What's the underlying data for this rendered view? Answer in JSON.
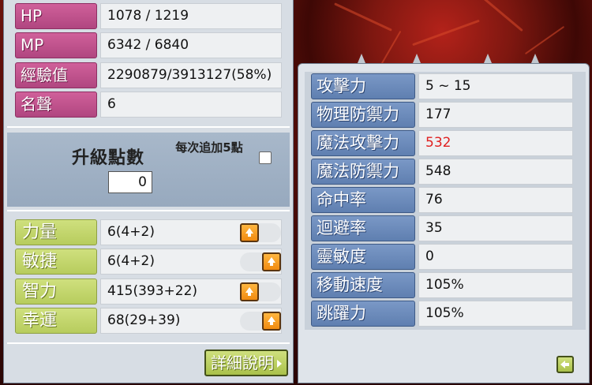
{
  "basic_stats": [
    {
      "label": "HP",
      "value": "1078 / 1219"
    },
    {
      "label": "MP",
      "value": "6342 / 6840"
    },
    {
      "label": "經驗值",
      "value": "2290879/3913127(58%)"
    },
    {
      "label": "名聲",
      "value": "6"
    }
  ],
  "ap_section": {
    "label": "升級點數",
    "value": "0",
    "auto_add_label": "每次追加5點",
    "auto_add_checked": false
  },
  "attributes": [
    {
      "label": "力量",
      "value": "6(4+2)",
      "button_side": "left"
    },
    {
      "label": "敏捷",
      "value": "6(4+2)",
      "button_side": "right"
    },
    {
      "label": "智力",
      "value": "415(393+22)",
      "button_side": "left"
    },
    {
      "label": "幸運",
      "value": "68(29+39)",
      "button_side": "right"
    }
  ],
  "detail_button": "詳細說明",
  "detail_stats": [
    {
      "label": "攻擊力",
      "value": "5 ~ 15"
    },
    {
      "label": "物理防禦力",
      "value": "177"
    },
    {
      "label": "魔法攻擊力",
      "value": "532",
      "highlight": "#e02020"
    },
    {
      "label": "魔法防禦力",
      "value": "548"
    },
    {
      "label": "命中率",
      "value": "76"
    },
    {
      "label": "迴避率",
      "value": "35"
    },
    {
      "label": "靈敏度",
      "value": "0"
    },
    {
      "label": "移動速度",
      "value": "105%"
    },
    {
      "label": "跳躍力",
      "value": "105%"
    }
  ],
  "icons": {
    "stat_up": "up-arrow-icon",
    "collapse": "left-arrow-icon"
  },
  "colors": {
    "basic_label": "#c0508a",
    "attribute_label": "#c2d66c",
    "detail_label": "#6f8dbd",
    "up_button": "#f39a1c",
    "highlight_value": "#e02020"
  }
}
